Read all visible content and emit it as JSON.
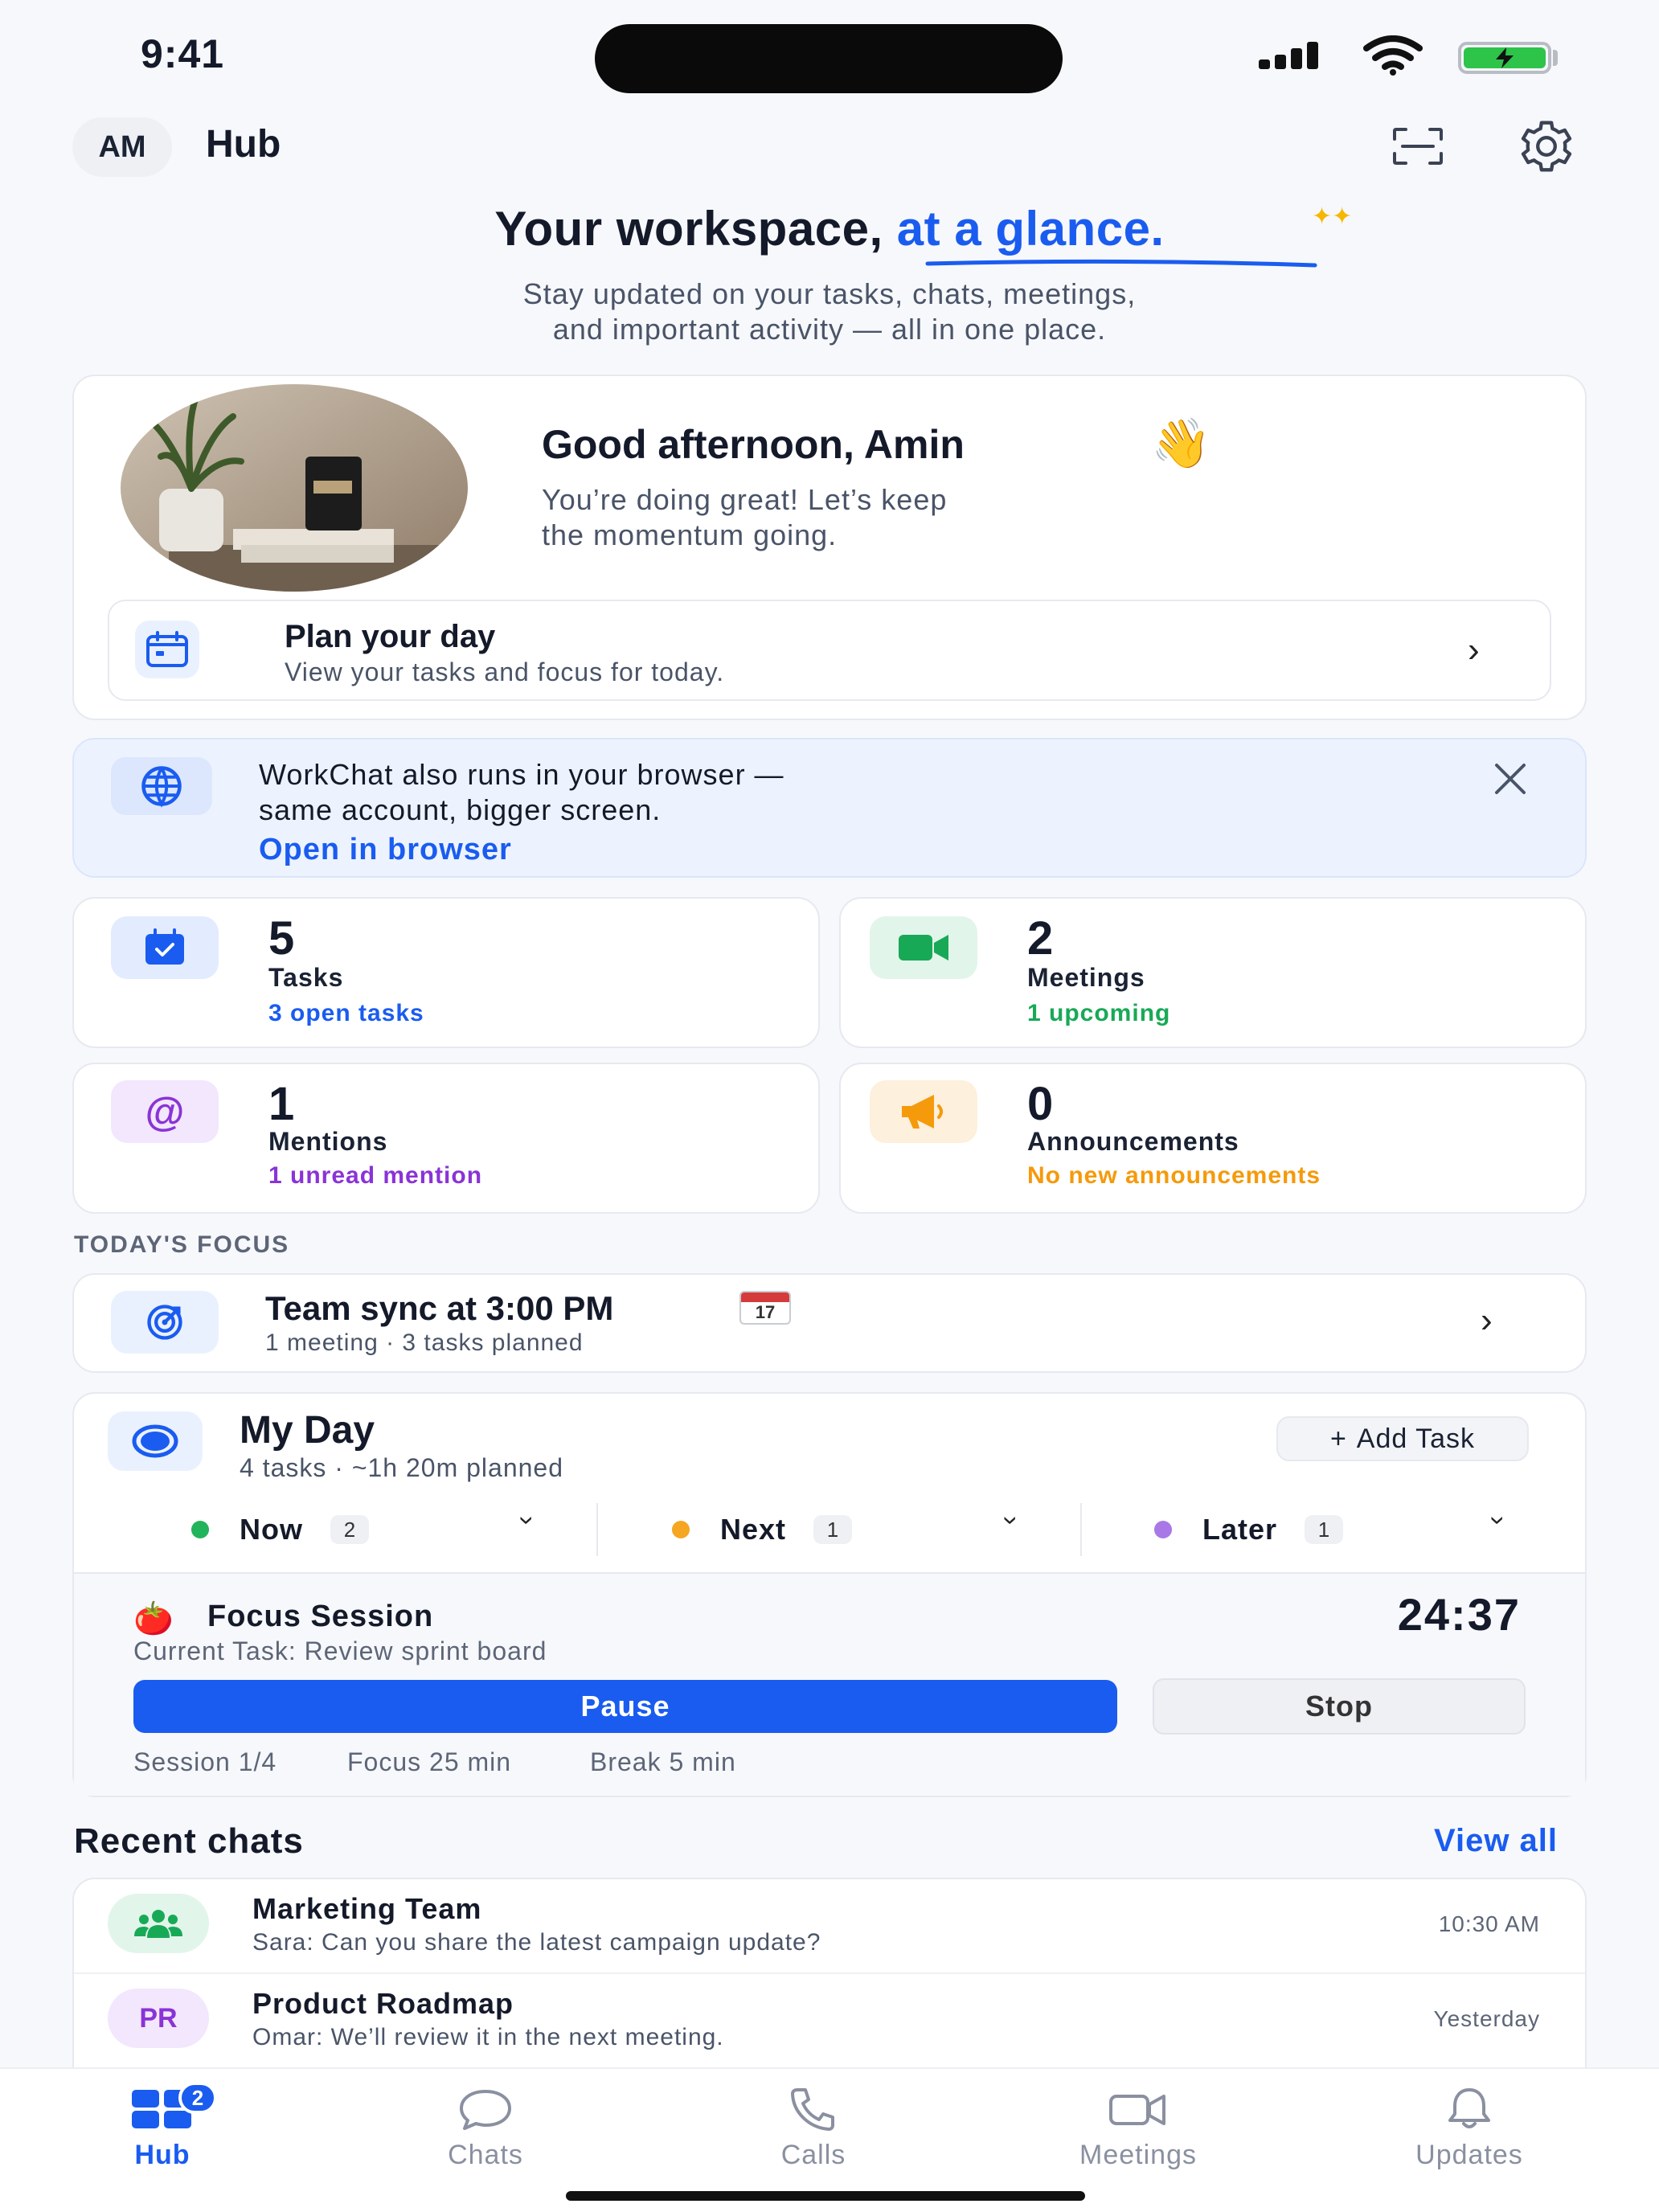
{
  "status_bar": {
    "time": "9:41"
  },
  "header": {
    "avatar_initials": "AM",
    "title": "Hub",
    "scan_icon": "scan-icon",
    "settings_icon": "gear-icon"
  },
  "hero": {
    "title_plain": "Your workspace, ",
    "title_accent": "at a glance.",
    "subtitle_line1": "Stay updated on your tasks, chats, meetings,",
    "subtitle_line2": "and important activity — all in one place."
  },
  "greeting": {
    "title": "Good afternoon, Amin",
    "emoji": "👋",
    "line1": "You’re doing great! Let’s keep",
    "line2": "the momentum going.",
    "plan": {
      "title": "Plan your day",
      "subtitle": "View your tasks and focus for today."
    }
  },
  "banner": {
    "line1": "WorkChat also runs in your browser —",
    "line2": "same account, bigger screen.",
    "link": "Open in browser"
  },
  "stats": [
    {
      "count": "5",
      "label": "Tasks",
      "sub": "3 open tasks",
      "color": "#1a5cf0",
      "icon": "task-check-icon"
    },
    {
      "count": "2",
      "label": "Meetings",
      "sub": "1 upcoming",
      "color": "#18a957",
      "icon": "video-camera-icon"
    },
    {
      "count": "1",
      "label": "Mentions",
      "sub": "1 unread mention",
      "color": "#8a33d6",
      "icon": "at-sign-icon"
    },
    {
      "count": "0",
      "label": "Announcements",
      "sub": "No new announcements",
      "color": "#f59a0b",
      "icon": "megaphone-icon"
    }
  ],
  "focus": {
    "section_label": "TODAY'S FOCUS",
    "title": "Team sync at 3:00 PM",
    "calendar_day": "17",
    "subtitle": "1 meeting · 3 tasks planned"
  },
  "my_day": {
    "title": "My Day",
    "subtitle": "4 tasks · ~1h 20m planned",
    "add_task": "Add Task",
    "segments": [
      {
        "name": "Now",
        "count": "2",
        "color": "#22b45a"
      },
      {
        "name": "Next",
        "count": "1",
        "color": "#f5a623"
      },
      {
        "name": "Later",
        "count": "1",
        "color": "#a879e6"
      }
    ],
    "session": {
      "title": "Focus Session",
      "current_task": "Current Task: Review sprint board",
      "timer": "24:37",
      "pause": "Pause",
      "stop": "Stop",
      "session": "Session 1/4",
      "focus": "Focus 25 min",
      "break": "Break 5 min"
    }
  },
  "recent_chats": {
    "title": "Recent chats",
    "view_all": "View all",
    "items": [
      {
        "name": "Marketing Team",
        "message": "Sara: Can you share the latest campaign update?",
        "time": "10:30 AM",
        "avatar": "",
        "avatar_icon": "group-icon"
      },
      {
        "name": "Product Roadmap",
        "message": "Omar: We’ll review it in the next meeting.",
        "time": "Yesterday",
        "avatar": "PR"
      }
    ]
  },
  "tabbar": {
    "items": [
      {
        "label": "Hub",
        "badge": "2",
        "icon": "grid-icon"
      },
      {
        "label": "Chats",
        "icon": "chat-bubble-icon"
      },
      {
        "label": "Calls",
        "icon": "phone-icon"
      },
      {
        "label": "Meetings",
        "icon": "video-icon"
      },
      {
        "label": "Updates",
        "icon": "bell-icon"
      }
    ]
  }
}
